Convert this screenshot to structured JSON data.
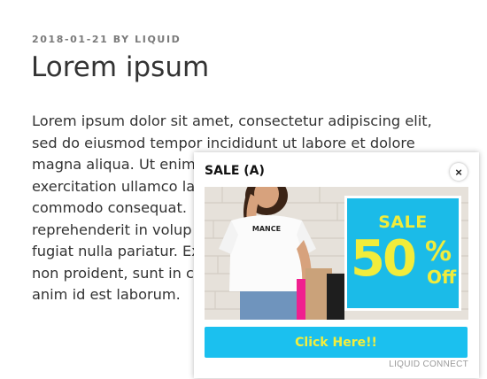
{
  "article": {
    "meta": "2018-01-21 BY LIQUID",
    "title": "Lorem ipsum",
    "body_lines": [
      "Lorem ipsum dolor sit amet, consectetur adipiscing elit,",
      "sed do eiusmod tempor incididunt ut labore et dolore",
      "magna aliqua. Ut enim",
      "exercitation ullamco la",
      "commodo consequat.",
      "reprehenderit in volup",
      "fugiat nulla pariatur. Ex",
      "non proident, sunt in c",
      "anim id est laborum."
    ]
  },
  "popup": {
    "title": "SALE (A)",
    "close_icon": "×",
    "shirt_text": "MANCE",
    "promo": {
      "sale_word": "SALE",
      "percent_number": "50",
      "percent_sign": "%",
      "off_word": "Off"
    },
    "cta_label": "Click Here!!",
    "branding": "LIQUID CONNECT",
    "colors": {
      "accent_blue": "#1bbbe8",
      "accent_yellow": "#f1ec3b"
    }
  }
}
